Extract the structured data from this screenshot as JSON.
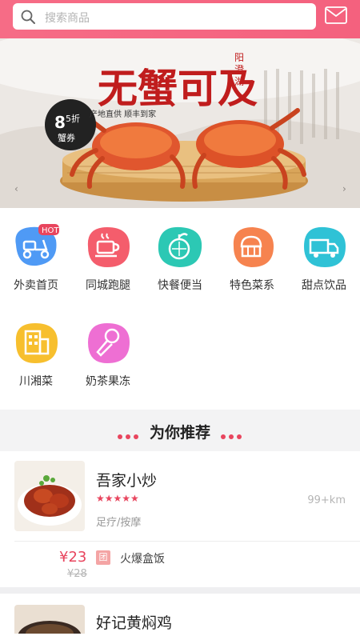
{
  "search": {
    "placeholder": "搜索商品"
  },
  "icons": {
    "search": "search-icon",
    "mail": "mail-icon"
  },
  "banner": {
    "headline": "无蟹可及",
    "brand": "阳澄湖",
    "tagline": "产地直供  顺丰到家",
    "coupon_discount": "8.5折",
    "coupon_label": "蟹券"
  },
  "categories": [
    {
      "label": "外卖首页",
      "icon": "scooter-icon",
      "badge": "HOT",
      "color": "#4f9af5"
    },
    {
      "label": "同城跑腿",
      "icon": "cup-icon",
      "color": "#f45d6c"
    },
    {
      "label": "快餐便当",
      "icon": "orange-icon",
      "color": "#2cc8b4"
    },
    {
      "label": "特色菜系",
      "icon": "cake-icon",
      "color": "#f6834f"
    },
    {
      "label": "甜点饮品",
      "icon": "truck-icon",
      "color": "#2fc2d6"
    },
    {
      "label": "川湘菜",
      "icon": "building-icon",
      "color": "#f7bf2e"
    },
    {
      "label": "奶茶果冻",
      "icon": "microphone-icon",
      "color": "#ee6fd3"
    }
  ],
  "recommend": {
    "title": "为你推荐"
  },
  "shops": [
    {
      "name": "吾家小炒",
      "rating": 5,
      "distance": "99+km",
      "tag": "足疗/按摩",
      "price": "¥23",
      "old_price": "¥28",
      "deal_badge": "团",
      "deal_text": "火爆盒饭"
    },
    {
      "name": "好记黄焖鸡"
    }
  ],
  "colors": {
    "accent": "#e8455e",
    "header": "#f4617e"
  }
}
